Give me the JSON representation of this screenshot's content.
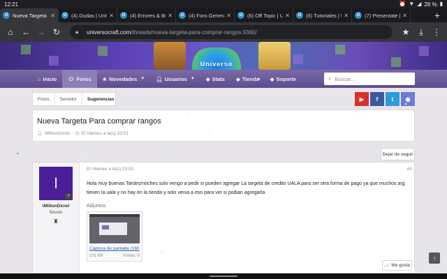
{
  "status_bar": {
    "time": "12:21",
    "battery": "28 %",
    "icons": [
      "alarm-icon",
      "wifi-icon",
      "signal-icon",
      "battery-icon"
    ]
  },
  "tabs": [
    {
      "title": "Nueva Targeta P",
      "active": true
    },
    {
      "title": "(4) Dudas | Univ",
      "active": false
    },
    {
      "title": "(4) Errores & Bu",
      "active": false
    },
    {
      "title": "(4) Foro General",
      "active": false
    },
    {
      "title": "(6) Off Topic | U",
      "active": false
    },
    {
      "title": "(6) Tutoriales | U",
      "active": false
    },
    {
      "title": "(7) Presentate |",
      "active": false
    }
  ],
  "address_bar": {
    "host": "universocraft.com",
    "path": "/threads/nueva-targeta-para-comprar-rangos.9360/"
  },
  "banner": {
    "logo_text": "Universo"
  },
  "nav": {
    "items": [
      {
        "label": "Inicio",
        "icon": "home-icon",
        "active": false,
        "dropdown": false
      },
      {
        "label": "Foros",
        "icon": "comments-icon",
        "active": true,
        "dropdown": false
      },
      {
        "label": "Novedades",
        "icon": "star-icon",
        "active": false,
        "dropdown": true
      },
      {
        "label": "Usuarios",
        "icon": "user-icon",
        "active": false,
        "dropdown": true
      },
      {
        "label": "Stats",
        "icon": "tag-icon",
        "active": false,
        "dropdown": false
      },
      {
        "label": "Tienda",
        "icon": "tag-icon",
        "active": false,
        "dropdown": false
      },
      {
        "label": "Soporte",
        "icon": "tag-icon",
        "active": false,
        "dropdown": false
      }
    ],
    "search_placeholder": "Buscar..."
  },
  "breadcrumb": [
    "Foros",
    "Servidor",
    "Sugerencias"
  ],
  "social": [
    {
      "name": "youtube",
      "glyph": "▶",
      "color": "#d9302c"
    },
    {
      "name": "facebook",
      "glyph": "f",
      "color": "#3b5b9c"
    },
    {
      "name": "twitter",
      "glyph": "t",
      "color": "#2c9bdc"
    },
    {
      "name": "discord",
      "glyph": "◉",
      "color": "#6f7ad8"
    }
  ],
  "thread": {
    "title": "Nueva Targeta Para comprar rangos",
    "author": "iMiltonDxnel",
    "date": "El Viernes a la(s) 23:01",
    "follow_label": "Dejar de seguir"
  },
  "post": {
    "user": {
      "name": "iMiltonDxnel",
      "role": "Novato",
      "avatar_letter": "I"
    },
    "date": "El Viernes a la(s) 23:01",
    "number": "#1",
    "text": "Hola muy buenas Tardes/noches solo vengo a pedir si pueden agregar La targeta de credito UALA para ser otra forma de pago ya que muchos arg tienen la uala y no hay en la tienda y solo venia a eso para ver si podian agregarla",
    "attachments_label": "Adjuntos",
    "attachment": {
      "name": "Captura de pantalla (160...",
      "size": "101 KB",
      "views": "Visitas: 6"
    },
    "like_label": "Me gusta"
  },
  "colors": {
    "nav_bg": "#6a5a9c",
    "avatar_bg": "#4a1e9a",
    "link": "#2a62a8"
  }
}
